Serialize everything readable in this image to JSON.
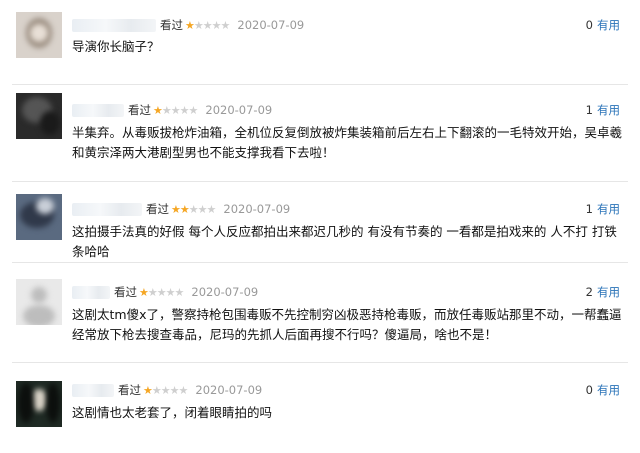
{
  "reviews": [
    {
      "seen_label": "看过",
      "stars": 1,
      "date": "2020-07-09",
      "useful_count": "0",
      "useful_label": "有用",
      "text": "导演你长脑子？"
    },
    {
      "seen_label": "看过",
      "stars": 1,
      "date": "2020-07-09",
      "useful_count": "1",
      "useful_label": "有用",
      "text": "半集弃。从毒贩拔枪炸油箱，全机位反复倒放被炸集装箱前后左右上下翻滚的一毛特效开始，吴卓羲和黄宗泽两大港剧型男也不能支撑我看下去啦！"
    },
    {
      "seen_label": "看过",
      "stars": 2,
      "date": "2020-07-09",
      "useful_count": "1",
      "useful_label": "有用",
      "text": "这拍摄手法真的好假 每个人反应都拍出来都迟几秒的 有没有节奏的 一看都是拍戏来的 人不打 打铁条哈哈"
    },
    {
      "seen_label": "看过",
      "stars": 1,
      "date": "2020-07-09",
      "useful_count": "2",
      "useful_label": "有用",
      "text": "这剧太tm傻x了，警察持枪包围毒贩不先控制穷凶极恶持枪毒贩，而放任毒贩站那里不动，一帮蠢逼经常放下枪去搜查毒品，尼玛的先抓人后面再搜不行吗？傻逼局，啥也不是！"
    },
    {
      "seen_label": "看过",
      "stars": 1,
      "date": "2020-07-09",
      "useful_count": "0",
      "useful_label": "有用",
      "text": "这剧情也太老套了，闭着眼睛拍的吗"
    }
  ]
}
